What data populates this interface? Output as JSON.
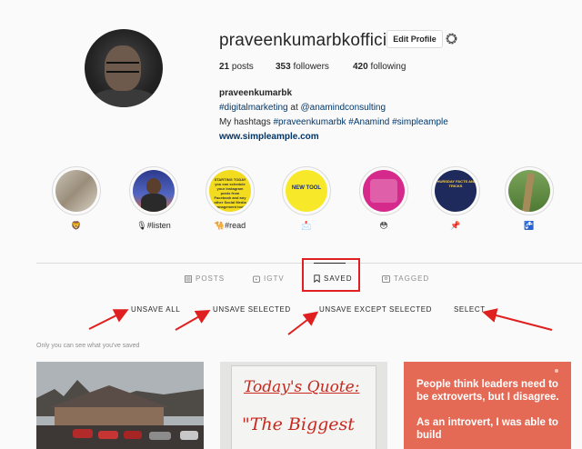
{
  "profile": {
    "username": "praveenkumarbkofficial",
    "edit_label": "Edit Profile",
    "settings_icon": "gear-icon",
    "stats": {
      "posts_count": "21",
      "posts_label": "posts",
      "followers_count": "353",
      "followers_label": "followers",
      "following_count": "420",
      "following_label": "following"
    },
    "bio": {
      "name": "praveenkumarbk",
      "line1_tag": "#digitalmarketing",
      "line1_at": "at",
      "line1_handle": "@anamindconsulting",
      "line2_prefix": "My hashtags",
      "line2_tags": "#praveenkumarbk #Anamind #simpleample",
      "website": "www.simpleample.com"
    }
  },
  "highlights": [
    {
      "label": "🦁"
    },
    {
      "label": "🎙#listen"
    },
    {
      "label": "🐪#read"
    },
    {
      "label": "📩"
    },
    {
      "label": "😳"
    },
    {
      "label": "📌"
    },
    {
      "label": "🚰"
    }
  ],
  "highlight_text": {
    "h3": "STARTING TODAY you can schedule your Instagram posts from Facebook and any other Social Media management tools",
    "h4": "NEW TOOL",
    "h6": "THURSDAY FACTS AND TRICKS"
  },
  "tabs": [
    {
      "label": "POSTS",
      "icon": "grid-icon"
    },
    {
      "label": "IGTV",
      "icon": "igtv-icon"
    },
    {
      "label": "SAVED",
      "icon": "bookmark-icon"
    },
    {
      "label": "TAGGED",
      "icon": "tagged-icon"
    }
  ],
  "actions": {
    "unsave_all": "UNSAVE ALL",
    "unsave_selected": "UNSAVE SELECTED",
    "unsave_except": "UNSAVE EXCEPT SELECTED",
    "select": "SELECT"
  },
  "saved_note": "Only you can see what you've saved",
  "posts": {
    "p2_line1": "Today's Quote:",
    "p2_line2": "\"The Biggest",
    "p3_quote": "People think leaders need to be extroverts, but I disagree.\n\nAs an introvert, I was able to build"
  },
  "colors": {
    "annotation_red": "#e02020",
    "link_blue": "#00376b",
    "muted_gray": "#8e8e8e"
  }
}
